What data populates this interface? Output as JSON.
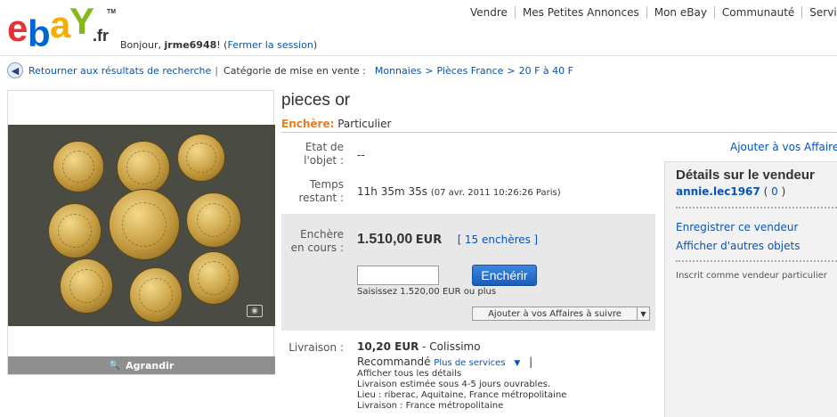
{
  "header": {
    "logo": {
      "letters": [
        "e",
        "b",
        "a",
        "Y"
      ],
      "suffix": ".fr",
      "tm": "TM",
      "colors": [
        "#e53238",
        "#0064d2",
        "#f5af02",
        "#86b817"
      ]
    },
    "greeting_prefix": "Bonjour,",
    "username": "jrme6948",
    "greeting_suffix": "! (",
    "signout_label": "Fermer la session",
    "greeting_close": ")",
    "nav": [
      "Vendre",
      "Mes Petites Annonces",
      "Mon eBay",
      "Communauté",
      "Service"
    ]
  },
  "breadcrumb": {
    "back_label": "Retourner aux résultats de recherche",
    "separator": "|",
    "category_label": "Catégorie de mise en vente :",
    "path": [
      "Monnaies",
      "Pièces France",
      "20 F à 40 F"
    ],
    "gt": ">"
  },
  "image_panel": {
    "enlarge_label": "Agrandir",
    "zoom_icon": "🔍",
    "camera_icon": "◉"
  },
  "item": {
    "title": "pieces or",
    "format_label": "Enchère:",
    "format_value": "Particulier",
    "add_watch_top": "Ajouter à vos Affaires",
    "fields": {
      "condition_label": [
        "Etat de",
        "l'objet :"
      ],
      "condition_value": "--",
      "time_label": [
        "Temps",
        "restant :"
      ],
      "time_value": "11h 35m 35s",
      "time_detail": "(07 avr. 2011 10:26:26 Paris)"
    },
    "bid": {
      "label": [
        "Enchère",
        "en cours :"
      ],
      "price": "1.510,00",
      "currency": "EUR",
      "bids_open": "[",
      "bids_link": "15 enchères",
      "bids_close": "]",
      "input_value": "",
      "button_label": "Enchérir",
      "hint": "Saisissez 1.520,00 EUR ou plus",
      "watch_label": "Ajouter à vos Affaires à suivre"
    },
    "shipping": {
      "label": "Livraison :",
      "price": "10,20 EUR",
      "carrier": "- Colissimo",
      "carrier2": "Recommandé",
      "more_services": "Plus de services",
      "pipe": "|",
      "all_details": "Afficher tous les détails",
      "estimate": "Livraison estimée sous 4-5 jours ouvrables.",
      "location": "Lieu : riberac, Aquitaine, France métropolitaine",
      "ship_to": "Livraison : France métropolitaine"
    }
  },
  "seller": {
    "heading": "Détails sur le vendeur",
    "name": "annie.lec1967",
    "score_open": "(",
    "score": "0",
    "score_close": ")",
    "save_label": "Enregistrer ce vendeur",
    "other_items_label": "Afficher d'autres objets",
    "info": "Inscrit comme vendeur particulier"
  }
}
